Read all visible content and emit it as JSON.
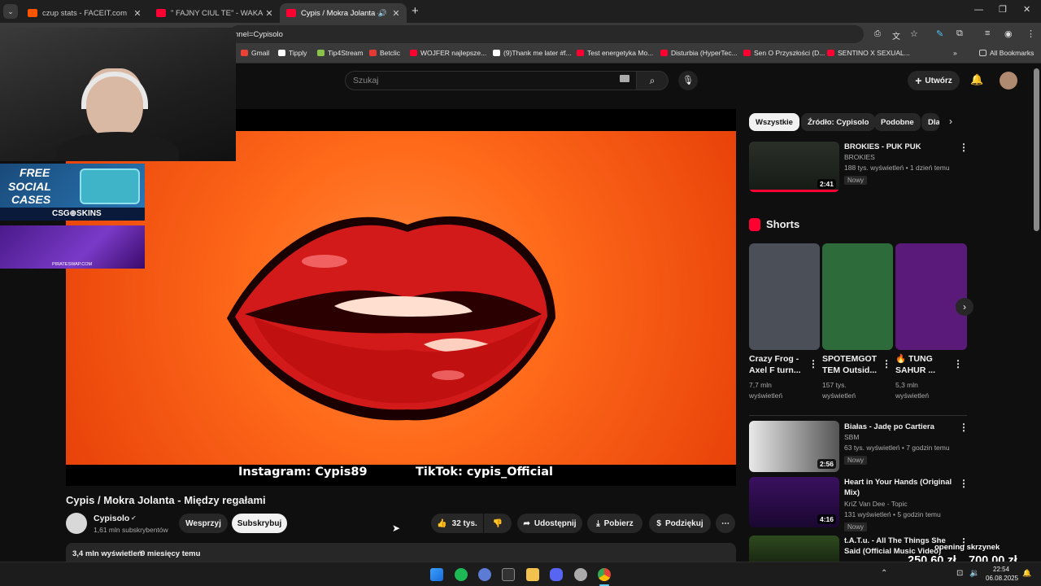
{
  "tabs": [
    {
      "title": "czup stats - FACEIT.com",
      "color": "#ff5500"
    },
    {
      "title": "\" FAJNY CIUL TE\" - WAKACY",
      "color": "#ff0033"
    },
    {
      "title": "Cypis / Mokra Jolanta - Mię",
      "color": "#ff0033"
    }
  ],
  "address": {
    "url": "nnel=Cypisolo"
  },
  "bookmarks": [
    {
      "label": "Gmail",
      "color": "#ea4335"
    },
    {
      "label": "Tipply",
      "color": "#ffffff"
    },
    {
      "label": "Tip4Stream",
      "color": "#8bc34a"
    },
    {
      "label": "Betclic",
      "color": "#e53935"
    },
    {
      "label": "WOJFER najlepsze...",
      "color": "#ff0033"
    },
    {
      "label": "(9)Thank me later #f...",
      "color": "#ffffff"
    },
    {
      "label": "Test energetyka Mo...",
      "color": "#ff0033"
    },
    {
      "label": "Disturbia (HyperTec...",
      "color": "#ff0033"
    },
    {
      "label": "Sen O Przyszłości (D...",
      "color": "#ff0033"
    },
    {
      "label": "SENTINO X SEXUAL...",
      "color": "#ff0033"
    },
    {
      "label": "All Bookmarks",
      "color": "#cccccc"
    }
  ],
  "search": {
    "placeholder": "Szukaj"
  },
  "header": {
    "create_label": "Utwórz"
  },
  "overlay": {
    "promo1_line1": "FREE",
    "promo1_line2": "SOCIAL",
    "promo1_line3": "CASES",
    "promo1_brand": "CSG⊕SKINS",
    "promo2_brand": "PIRATESWAP.COM"
  },
  "video": {
    "caption_instagram": "Instagram: Cypis89",
    "caption_tiktok": "TikTok: cypis_Official",
    "title": "Cypis / Mokra Jolanta - Między regałami",
    "channel": "Cypisolo",
    "subscribers": "1,61 mln subskrybentów",
    "join_label": "Wesprzyj",
    "subscribe_label": "Subskrybuj",
    "likes": "32 tys.",
    "share_label": "Udostępnij",
    "download_label": "Pobierz",
    "thanks_label": "Podziękuj",
    "views": "3,4 mln wyświetleń",
    "age": "9 miesięcy temu"
  },
  "chips": [
    "Wszystkie",
    "Źródło: Cypisolo",
    "Podobne",
    "Dla"
  ],
  "shorts_title": "Shorts",
  "shorts": [
    {
      "line1": "Crazy Frog -",
      "line2": "Axel F turn...",
      "views": "7,7 mln",
      "unit": "wyświetleń",
      "color": "#4a4f58"
    },
    {
      "line1": "SPOTEMGOT",
      "line2": "TEM Outsid...",
      "views": "157 tys.",
      "unit": "wyświetleń",
      "color": "#2e6b3a"
    },
    {
      "line1": "🔥 TUNG",
      "line2": "SAHUR ...",
      "views": "5,3 mln",
      "unit": "wyświetleń",
      "color": "#5a1a7a"
    }
  ],
  "top_rec": {
    "title": "BROKIES - PUK PUK",
    "channel": "BROKIES",
    "meta": "188 tys. wyświetleń • 1 dzień temu",
    "badge": "Nowy",
    "duration": "2:41"
  },
  "recs": [
    {
      "title": "Białas - Jadę po Cartiera",
      "title2": "",
      "channel": "SBM",
      "meta": "63 tys. wyświetleń • 7 godzin temu",
      "badge": "Nowy",
      "duration": "2:56"
    },
    {
      "title": "Heart in Your Hands (Original",
      "title2": "Mix)",
      "channel": "KriZ Van Dee - Topic",
      "meta": "131 wyświetleń • 5 godzin temu",
      "badge": "Nowy",
      "duration": "4:16"
    },
    {
      "title": "t.A.T.u. - All The Things She",
      "title2": "Said (Official Music Video)",
      "channel": "",
      "meta": "",
      "badge": "",
      "duration": ""
    }
  ],
  "stream_overlay": {
    "label": "opening skrzynek",
    "amount1": "250,60 zł",
    "amount2": "700,00 zł"
  },
  "taskbar": {
    "time": "22:54",
    "date": "06.08.2025"
  }
}
